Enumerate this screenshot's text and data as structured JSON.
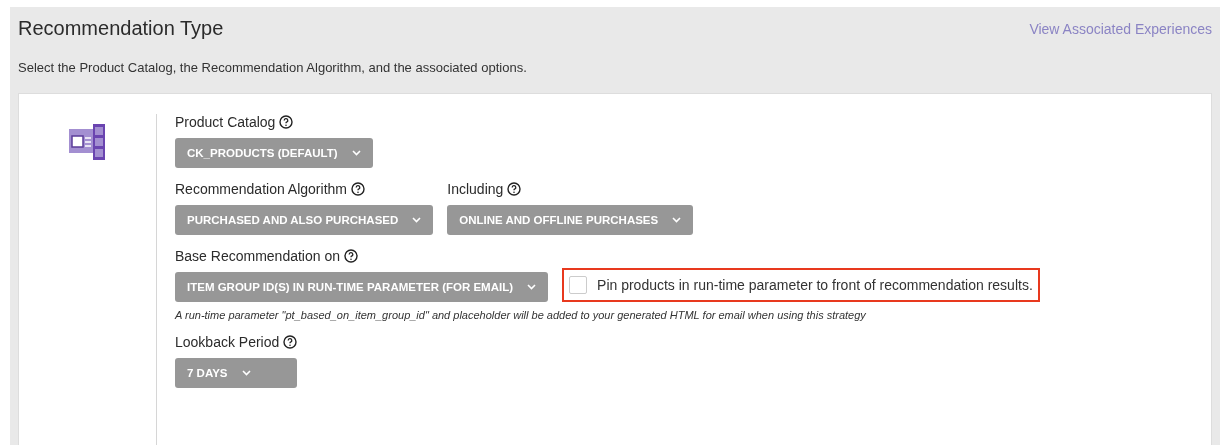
{
  "header": {
    "title": "Recommendation Type",
    "link": "View Associated Experiences",
    "description": "Select the Product Catalog, the Recommendation Algorithm, and the associated options."
  },
  "rows": [
    {
      "fields": [
        {
          "label": "Product Catalog",
          "value": "CK_PRODUCTS (DEFAULT)"
        }
      ]
    },
    {
      "fields": [
        {
          "label": "Recommendation Algorithm",
          "value": "PURCHASED AND ALSO PURCHASED"
        },
        {
          "label": "Including",
          "value": "ONLINE AND OFFLINE PURCHASES"
        }
      ]
    },
    {
      "fields": [
        {
          "label": "Base Recommendation on",
          "value": "ITEM GROUP ID(S) IN RUN-TIME PARAMETER (FOR EMAIL)"
        }
      ],
      "option": {
        "label": "Pin products in run-time parameter to front of recommendation results.",
        "checked": false,
        "highlighted": true
      },
      "note": "A run-time parameter \"pt_based_on_item_group_id\" and placeholder will be added to your generated HTML for email when using this strategy"
    },
    {
      "fields": [
        {
          "label": "Lookback Period",
          "value": "7 DAYS"
        }
      ]
    }
  ]
}
